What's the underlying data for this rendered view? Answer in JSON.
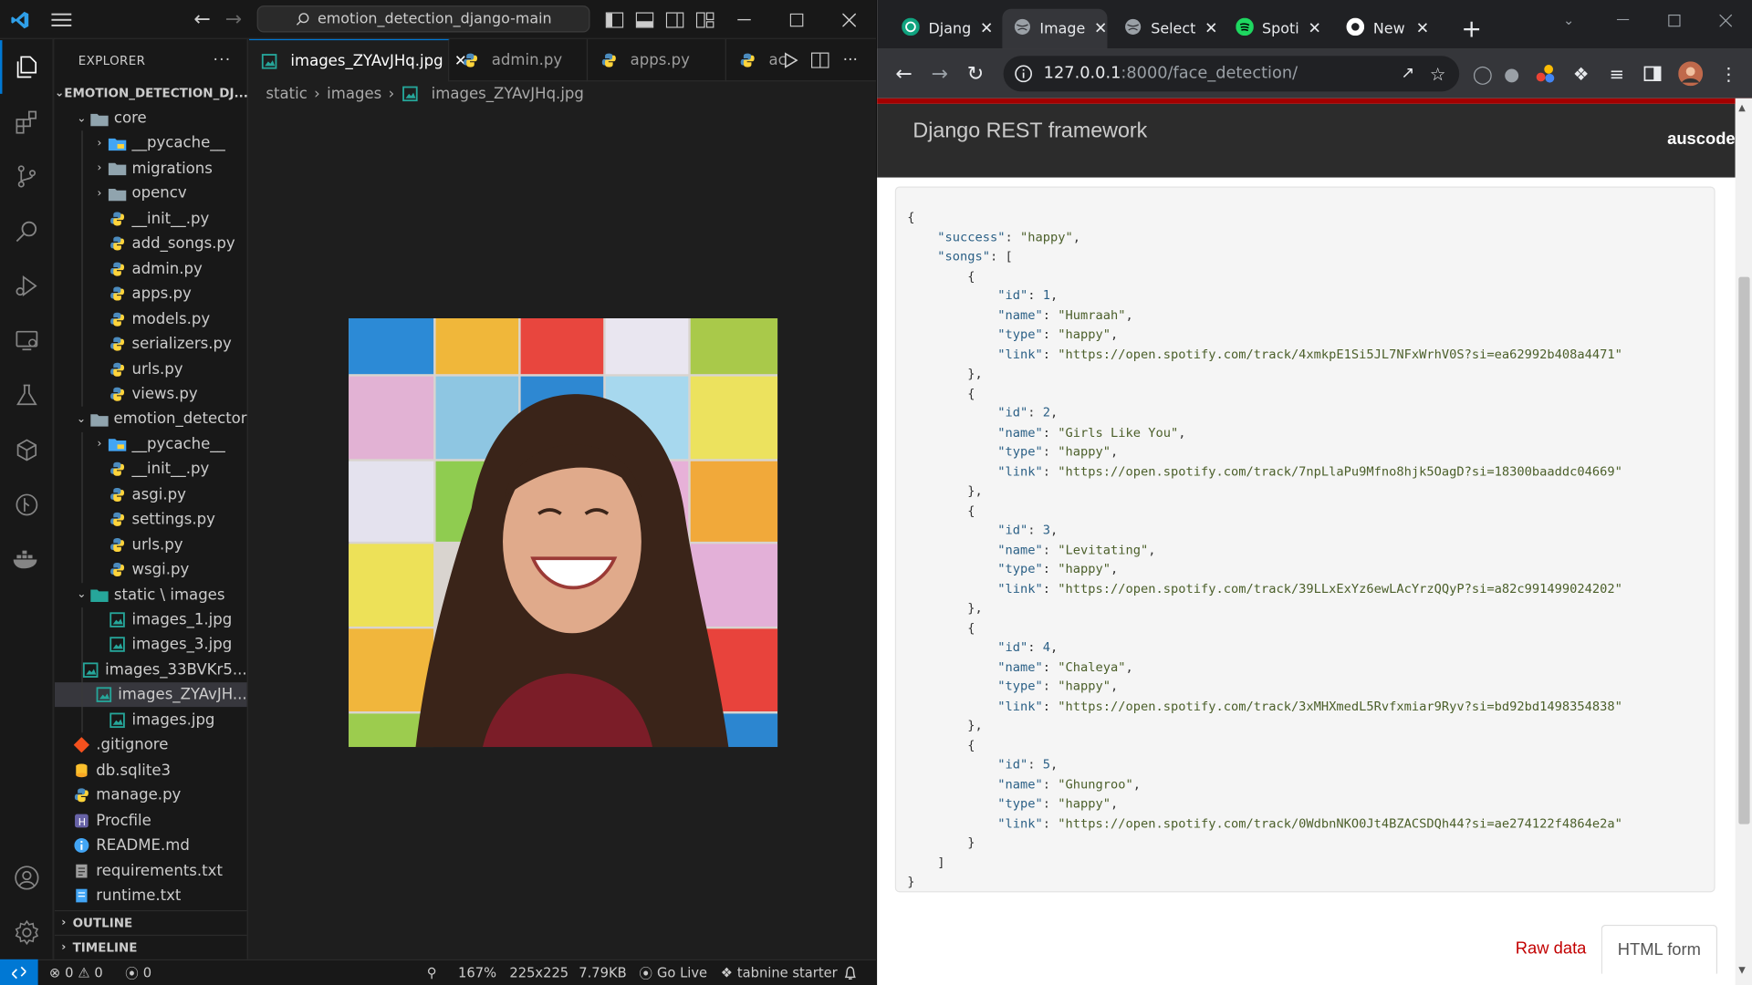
{
  "vscode": {
    "search": "emotion_detection_django-main",
    "explorer": {
      "title": "EXPLORER",
      "root": "EMOTION_DETECTION_DJ...",
      "items": [
        {
          "label": "core",
          "depth": 1,
          "kind": "folder-open",
          "type": "folder"
        },
        {
          "label": "__pycache__",
          "depth": 2,
          "kind": "folder-closed",
          "type": "folder-special"
        },
        {
          "label": "migrations",
          "depth": 2,
          "kind": "folder-closed",
          "type": "folder"
        },
        {
          "label": "opencv",
          "depth": 2,
          "kind": "folder-closed",
          "type": "folder"
        },
        {
          "label": "__init__.py",
          "depth": 2,
          "kind": "file",
          "type": "python"
        },
        {
          "label": "add_songs.py",
          "depth": 2,
          "kind": "file",
          "type": "python"
        },
        {
          "label": "admin.py",
          "depth": 2,
          "kind": "file",
          "type": "python"
        },
        {
          "label": "apps.py",
          "depth": 2,
          "kind": "file",
          "type": "python"
        },
        {
          "label": "models.py",
          "depth": 2,
          "kind": "file",
          "type": "python"
        },
        {
          "label": "serializers.py",
          "depth": 2,
          "kind": "file",
          "type": "python"
        },
        {
          "label": "urls.py",
          "depth": 2,
          "kind": "file",
          "type": "python"
        },
        {
          "label": "views.py",
          "depth": 2,
          "kind": "file",
          "type": "python"
        },
        {
          "label": "emotion_detector",
          "depth": 1,
          "kind": "folder-open",
          "type": "folder"
        },
        {
          "label": "__pycache__",
          "depth": 2,
          "kind": "folder-closed",
          "type": "folder-special"
        },
        {
          "label": "__init__.py",
          "depth": 2,
          "kind": "file",
          "type": "python"
        },
        {
          "label": "asgi.py",
          "depth": 2,
          "kind": "file",
          "type": "python"
        },
        {
          "label": "settings.py",
          "depth": 2,
          "kind": "file",
          "type": "python"
        },
        {
          "label": "urls.py",
          "depth": 2,
          "kind": "file",
          "type": "python"
        },
        {
          "label": "wsgi.py",
          "depth": 2,
          "kind": "file",
          "type": "python"
        },
        {
          "label": "static \\ images",
          "depth": 1,
          "kind": "folder-open",
          "type": "folder-static"
        },
        {
          "label": "images_1.jpg",
          "depth": 2,
          "kind": "file",
          "type": "image"
        },
        {
          "label": "images_3.jpg",
          "depth": 2,
          "kind": "file",
          "type": "image"
        },
        {
          "label": "images_33BVKr5...",
          "depth": 2,
          "kind": "file",
          "type": "image"
        },
        {
          "label": "images_ZYAvJH...",
          "depth": 2,
          "kind": "file",
          "type": "image",
          "selected": true
        },
        {
          "label": "images.jpg",
          "depth": 2,
          "kind": "file",
          "type": "image"
        },
        {
          "label": ".gitignore",
          "depth": 1,
          "kind": "file",
          "type": "git"
        },
        {
          "label": "db.sqlite3",
          "depth": 1,
          "kind": "file",
          "type": "db"
        },
        {
          "label": "manage.py",
          "depth": 1,
          "kind": "file",
          "type": "python"
        },
        {
          "label": "Procfile",
          "depth": 1,
          "kind": "file",
          "type": "heroku"
        },
        {
          "label": "README.md",
          "depth": 1,
          "kind": "file",
          "type": "info"
        },
        {
          "label": "requirements.txt",
          "depth": 1,
          "kind": "file",
          "type": "text"
        },
        {
          "label": "runtime.txt",
          "depth": 1,
          "kind": "file",
          "type": "text-blue"
        }
      ],
      "outline": "OUTLINE",
      "timeline": "TIMELINE"
    },
    "tabs": [
      {
        "label": "images_ZYAvJHq.jpg",
        "type": "image",
        "active": true
      },
      {
        "label": "admin.py",
        "type": "python"
      },
      {
        "label": "apps.py",
        "type": "python"
      },
      {
        "label": "ac",
        "type": "python"
      }
    ],
    "breadcrumb": [
      "static",
      "images",
      "images_ZYAvJHq.jpg"
    ],
    "statusbar": {
      "errors": "0",
      "warnings": "0",
      "ports": "0",
      "zoom": "167%",
      "dimensions": "225x225",
      "size": "7.79KB",
      "golive": "Go Live",
      "tabnine": "tabnine starter"
    }
  },
  "chrome": {
    "tabs": [
      {
        "label": "Djang",
        "icon": "chatgpt-icon"
      },
      {
        "label": "Image",
        "icon": "globe-icon",
        "active": true
      },
      {
        "label": "Select",
        "icon": "globe-icon"
      },
      {
        "label": "Spoti",
        "icon": "spotify-icon"
      },
      {
        "label": "New",
        "icon": "chrome-icon"
      }
    ],
    "url_host": "127.0.0.1",
    "url_path": ":8000/face_detection/"
  },
  "drf": {
    "brand": "Django REST framework",
    "user": "auscode",
    "response": {
      "success": "happy",
      "songs": [
        {
          "id": 1,
          "name": "Humraah",
          "type": "happy",
          "link": "https://open.spotify.com/track/4xmkpE1Si5JL7NFxWrhV0S?si=ea62992b408a4471"
        },
        {
          "id": 2,
          "name": "Girls Like You",
          "type": "happy",
          "link": "https://open.spotify.com/track/7npLlaPu9Mfno8hjk5OagD?si=18300baaddc04669"
        },
        {
          "id": 3,
          "name": "Levitating",
          "type": "happy",
          "link": "https://open.spotify.com/track/39LLxExYz6ewLAcYrzQQyP?si=a82c991499024202"
        },
        {
          "id": 4,
          "name": "Chaleya",
          "type": "happy",
          "link": "https://open.spotify.com/track/3xMHXmedL5Rvfxmiar9Ryv?si=bd92bd1498354838"
        },
        {
          "id": 5,
          "name": "Ghungroo",
          "type": "happy",
          "link": "https://open.spotify.com/track/0WdbnNKO0Jt4BZACSDQh44?si=ae274122f4864e2a"
        }
      ]
    },
    "raw_data": "Raw data",
    "html_form": "HTML form"
  }
}
